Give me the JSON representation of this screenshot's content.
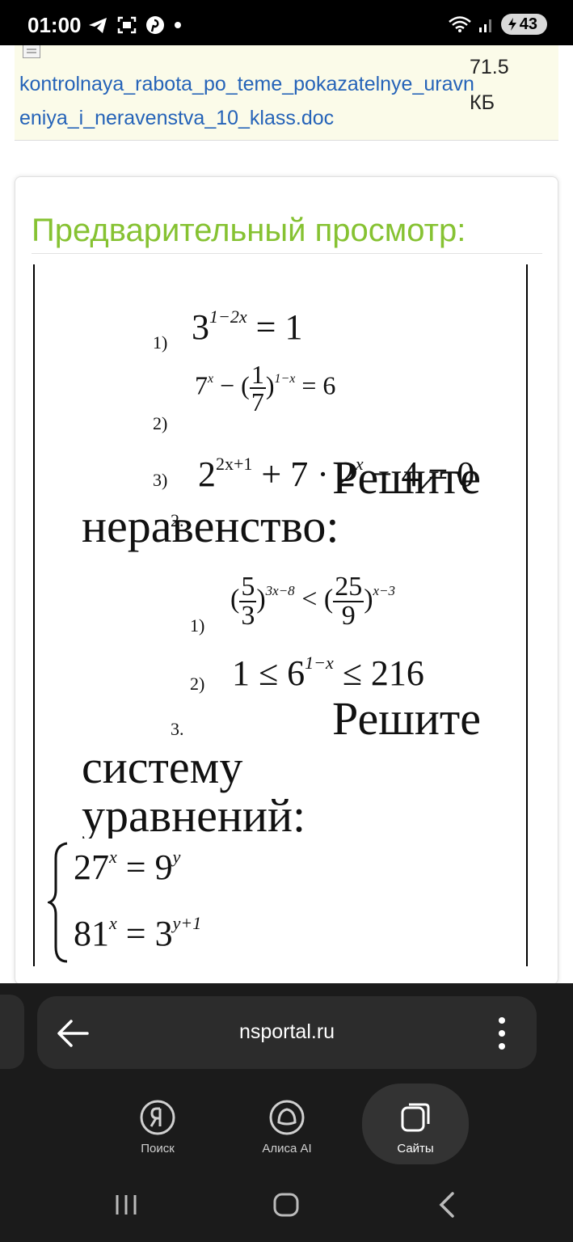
{
  "status_bar": {
    "time": "01:00",
    "battery": "43",
    "icons_left": [
      "telegram-icon",
      "screenshot-icon",
      "pinterest-icon",
      "dot-icon"
    ],
    "icons_right": [
      "wifi-icon",
      "signal-icon",
      "battery-icon"
    ]
  },
  "file": {
    "link": "kontrolnaya_rabota_po_teme_pokazatelnye_uravneniya_i_neravenstva_10_klass.doc",
    "size": "71.5 КБ"
  },
  "preview": {
    "title": "Предварительный просмотр:"
  },
  "document": {
    "section1": {
      "items": [
        {
          "num": "1)"
        },
        {
          "num": "2)"
        },
        {
          "num": "3)"
        }
      ],
      "eq3": "2",
      "eq3_exp": "2x+1",
      "eq3_rest": " + 7 · 2",
      "eq3_exp2": "x",
      "eq3_tail": " − 4 = 0"
    },
    "section2": {
      "num": "2.",
      "heading_line1": "Решите",
      "heading_line2": "неравенство:",
      "items": [
        {
          "num": "1)"
        },
        {
          "num": "2)"
        }
      ]
    },
    "section3": {
      "num": "3.",
      "heading_line1": "Решите",
      "heading_line2": "систему",
      "heading_line3": "уравнений:"
    }
  },
  "browser": {
    "url": "nsportal.ru",
    "back_label": "back-arrow-icon",
    "menu_label": "more-vert-icon"
  },
  "bottom_nav": {
    "items": [
      {
        "label": "Поиск",
        "icon": "yandex-icon",
        "active": false
      },
      {
        "label": "Алиса AI",
        "icon": "alice-icon",
        "active": false
      },
      {
        "label": "Сайты",
        "icon": "sites-icon",
        "active": true
      }
    ]
  },
  "system_nav": {
    "buttons": [
      "recents-icon",
      "home-icon",
      "back-icon"
    ]
  }
}
